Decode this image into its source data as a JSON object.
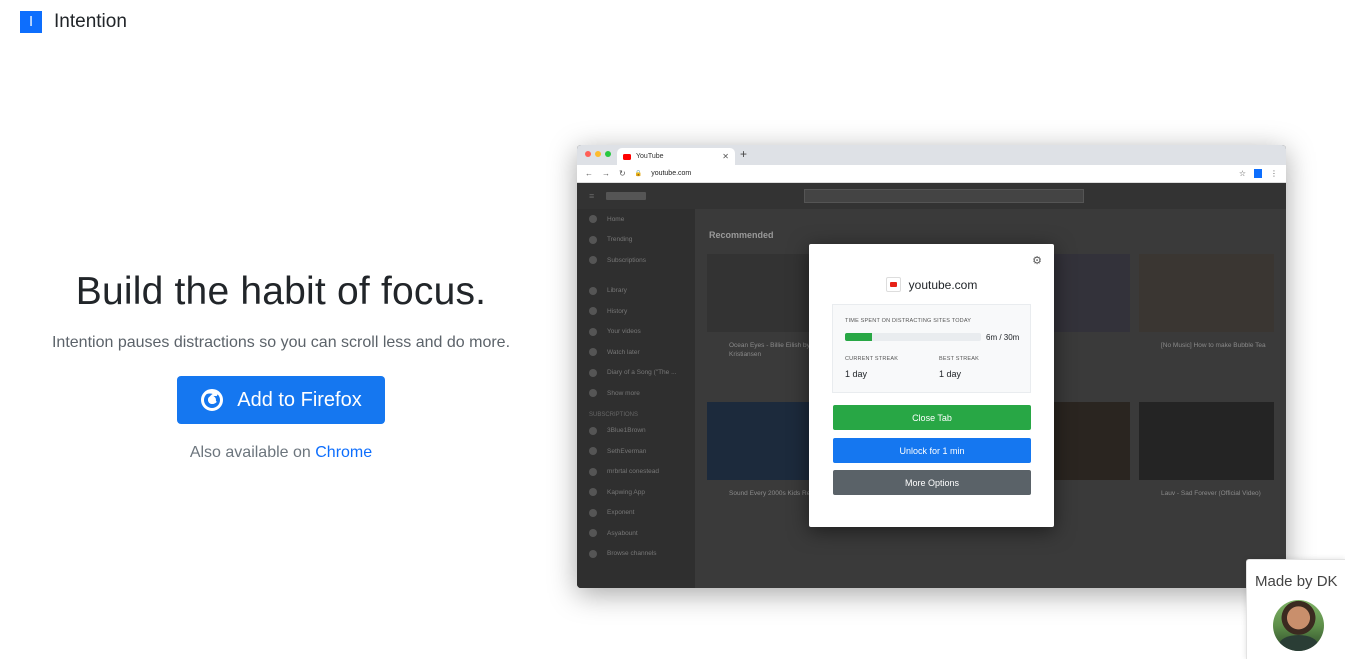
{
  "header": {
    "logo_letter": "I",
    "brand_name": "Intention"
  },
  "hero": {
    "title_prefix": "Build the habit of",
    "title_emphasis": "focus.",
    "subtitle": "Intention pauses distractions so you can scroll less and do more.",
    "cta_label": "Add to Firefox",
    "also_text": "Also available on",
    "also_link": "Chrome"
  },
  "mockup": {
    "tab_title": "YouTube",
    "url": "youtube.com",
    "yt_sidebar": [
      "Home",
      "Trending",
      "Subscriptions",
      "Library",
      "History",
      "Your videos",
      "Watch later",
      "Diary of a Song (\"The ...",
      "Show more"
    ],
    "yt_subs_heading": "SUBSCRIPTIONS",
    "yt_subs": [
      "3Blue1Brown",
      "SethEverman",
      "mrbrtal conestead",
      "Kapwing App",
      "Exponent",
      "Asyabount",
      "Browse channels"
    ],
    "yt_section": "Recommended",
    "videos": [
      "Ocean Eyes - Billie Eilish by Sara Kristiansen",
      "[No Music] How to make Bubble Tea",
      "Sound Every 2000s Kids Remember",
      "Lauv - Sad Forever (Official Video)"
    ],
    "popup": {
      "site": "youtube.com",
      "time_label": "TIME SPENT ON DISTRACTING SITES TODAY",
      "time_value": "6m / 30m",
      "time_fraction": 0.2,
      "current_streak_label": "CURRENT STREAK",
      "current_streak_value": "1 day",
      "best_streak_label": "BEST STREAK",
      "best_streak_value": "1 day",
      "close_tab": "Close Tab",
      "unlock": "Unlock for 1 min",
      "more_options": "More Options"
    }
  },
  "footer": {
    "made_by": "Made by DK"
  },
  "colors": {
    "primary": "#1577f0",
    "success": "#28a745",
    "secondary": "#5a6268",
    "link": "#0d6efd"
  }
}
